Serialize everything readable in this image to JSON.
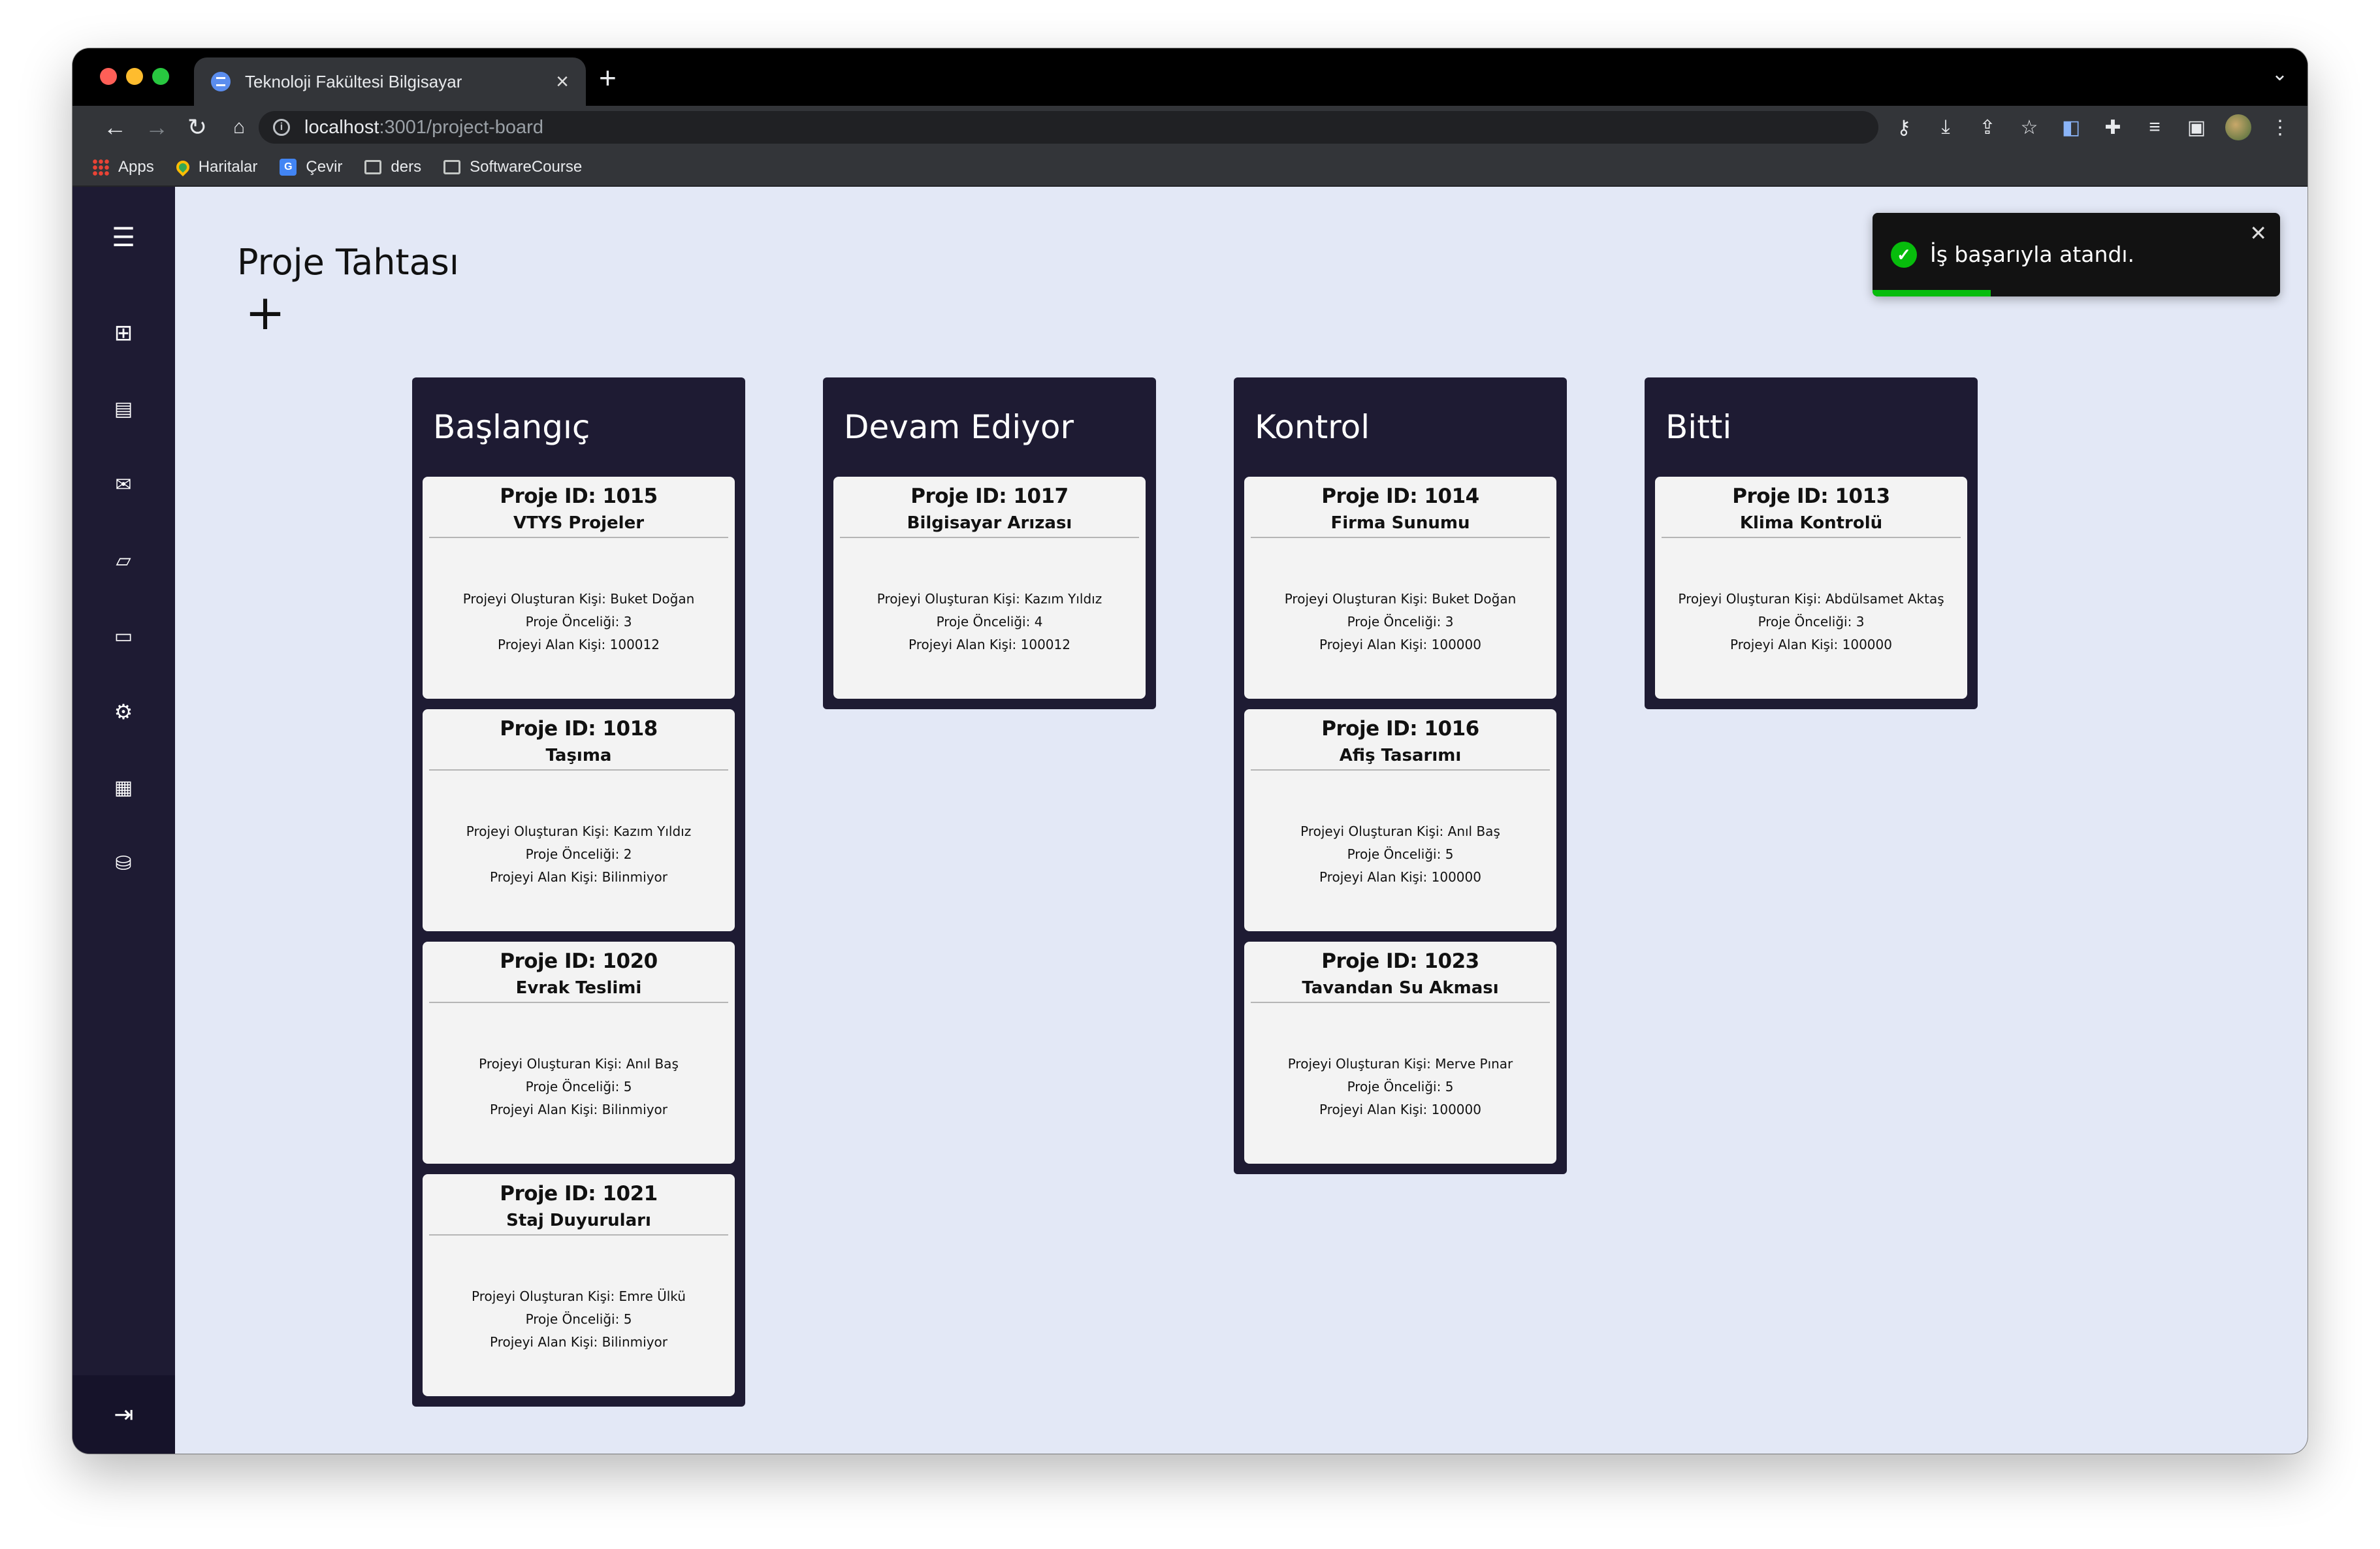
{
  "browser": {
    "tab_title": "Teknoloji Fakültesi Bilgisayar",
    "url_host": "localhost",
    "url_path": ":3001/project-board",
    "bookmarks": [
      {
        "label": "Apps",
        "icon": "apps-grid-icon"
      },
      {
        "label": "Haritalar",
        "icon": "maps-icon"
      },
      {
        "label": "Çevir",
        "icon": "translate-icon"
      },
      {
        "label": "ders",
        "icon": "folder-icon"
      },
      {
        "label": "SoftwareCourse",
        "icon": "folder-icon"
      }
    ]
  },
  "page": {
    "title": "Proje Tahtası",
    "add_symbol": "+"
  },
  "sidebar": {
    "icons": [
      "menu-icon",
      "dashboard-icon",
      "briefcase-icon",
      "mail-icon",
      "note-icon",
      "folder-icon",
      "settings-icon",
      "calendar-icon",
      "database-icon"
    ],
    "logout_icon": "logout-icon"
  },
  "board": {
    "columns": [
      {
        "title": "Başlangıç",
        "cards": [
          {
            "id": "Proje ID: 1015",
            "name": "VTYS Projeler",
            "creator": "Projeyi Oluşturan Kişi: Buket Doğan",
            "priority": "Proje Önceliği: 3",
            "assignee": "Projeyi Alan Kişi: 100012"
          },
          {
            "id": "Proje ID: 1018",
            "name": "Taşıma",
            "creator": "Projeyi Oluşturan Kişi: Kazım Yıldız",
            "priority": "Proje Önceliği: 2",
            "assignee": "Projeyi Alan Kişi: Bilinmiyor"
          },
          {
            "id": "Proje ID: 1020",
            "name": "Evrak Teslimi",
            "creator": "Projeyi Oluşturan Kişi: Anıl Baş",
            "priority": "Proje Önceliği: 5",
            "assignee": "Projeyi Alan Kişi: Bilinmiyor"
          },
          {
            "id": "Proje ID: 1021",
            "name": "Staj Duyuruları",
            "creator": "Projeyi Oluşturan Kişi: Emre Ülkü",
            "priority": "Proje Önceliği: 5",
            "assignee": "Projeyi Alan Kişi: Bilinmiyor"
          }
        ]
      },
      {
        "title": "Devam Ediyor",
        "cards": [
          {
            "id": "Proje ID: 1017",
            "name": "Bilgisayar Arızası",
            "creator": "Projeyi Oluşturan Kişi: Kazım Yıldız",
            "priority": "Proje Önceliği: 4",
            "assignee": "Projeyi Alan Kişi: 100012"
          }
        ]
      },
      {
        "title": "Kontrol",
        "cards": [
          {
            "id": "Proje ID: 1014",
            "name": "Firma Sunumu",
            "creator": "Projeyi Oluşturan Kişi: Buket Doğan",
            "priority": "Proje Önceliği: 3",
            "assignee": "Projeyi Alan Kişi: 100000"
          },
          {
            "id": "Proje ID: 1016",
            "name": "Afiş Tasarımı",
            "creator": "Projeyi Oluşturan Kişi: Anıl Baş",
            "priority": "Proje Önceliği: 5",
            "assignee": "Projeyi Alan Kişi: 100000"
          },
          {
            "id": "Proje ID: 1023",
            "name": "Tavandan Su Akması",
            "creator": "Projeyi Oluşturan Kişi: Merve Pınar",
            "priority": "Proje Önceliği: 5",
            "assignee": "Projeyi Alan Kişi: 100000"
          }
        ]
      },
      {
        "title": "Bitti",
        "cards": [
          {
            "id": "Proje ID: 1013",
            "name": "Klima Kontrolü",
            "creator": "Projeyi Oluşturan Kişi: Abdülsamet Aktaş",
            "priority": "Proje Önceliği: 3",
            "assignee": "Projeyi Alan Kişi: 100000"
          }
        ]
      }
    ]
  },
  "toast": {
    "message": "İş başarıyla atandı.",
    "progress": 0.29,
    "status_color": "#07bc0c"
  },
  "colors": {
    "sidebar": "#1e1b33",
    "background": "#e3e8f6",
    "card": "#f3f3f3"
  }
}
